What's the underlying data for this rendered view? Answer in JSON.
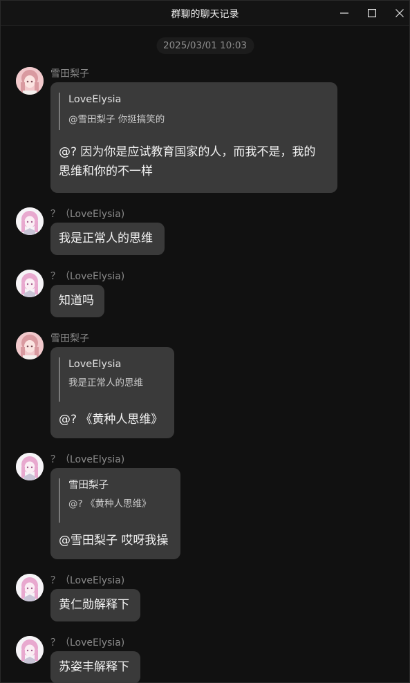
{
  "window": {
    "title": "群聊的聊天记录",
    "controls": {
      "minimize_icon": "minimize-icon",
      "maximize_icon": "maximize-icon",
      "close_icon": "close-icon"
    }
  },
  "timestamp": "2025/03/01 10:03",
  "messages": [
    {
      "sender": "雪田梨子",
      "avatar_icon": "avatar-pink",
      "quote": {
        "name": "LoveElysia",
        "text": "@雪田梨子 你挺搞笑的"
      },
      "lines": [
        "@? 因为你是应试教育国家的人，而我不是，我的",
        "思维和你的不一样"
      ]
    },
    {
      "sender": "？（LoveElysia)",
      "avatar_icon": "avatar-anime",
      "lines": [
        "我是正常人的思维"
      ]
    },
    {
      "sender": "？（LoveElysia)",
      "avatar_icon": "avatar-anime",
      "lines": [
        "知道吗"
      ]
    },
    {
      "sender": "雪田梨子",
      "avatar_icon": "avatar-pink",
      "quote": {
        "name": "LoveElysia",
        "text": "我是正常人的思维"
      },
      "lines": [
        "@? 《黄种人思维》"
      ]
    },
    {
      "sender": "？（LoveElysia)",
      "avatar_icon": "avatar-anime",
      "quote": {
        "name": "雪田梨子",
        "text": "@? 《黄种人思维》"
      },
      "lines": [
        "@雪田梨子 哎呀我操"
      ]
    },
    {
      "sender": "？（LoveElysia)",
      "avatar_icon": "avatar-anime",
      "lines": [
        "黄仁勋解释下"
      ]
    },
    {
      "sender": "？（LoveElysia)",
      "avatar_icon": "avatar-anime",
      "lines": [
        "苏姿丰解释下"
      ]
    }
  ],
  "colors": {
    "background": "#111111",
    "bubble": "#3a3a3a",
    "sender": "#8a8a8a",
    "quote_bar": "#7a7a7a"
  }
}
